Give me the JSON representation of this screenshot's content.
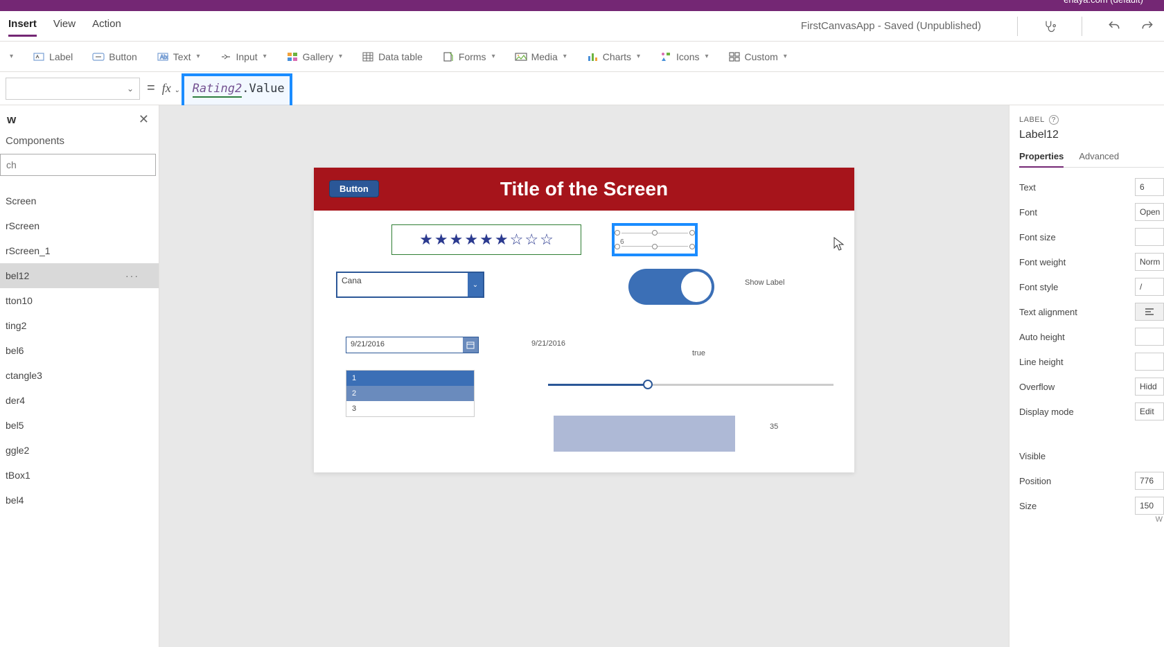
{
  "titlebar": {
    "text": "enaya.com (default)"
  },
  "menubar": {
    "tabs": [
      "Insert",
      "View",
      "Action"
    ],
    "active": 0,
    "status": "FirstCanvasApp - Saved (Unpublished)"
  },
  "ribbon": {
    "items": [
      "Label",
      "Button",
      "Text",
      "Input",
      "Gallery",
      "Data table",
      "Forms",
      "Media",
      "Charts",
      "Icons",
      "Custom"
    ]
  },
  "formulabar": {
    "property": "",
    "fx": "fx",
    "ref": "Rating2",
    "suffix": ".Value"
  },
  "tree": {
    "title": "w",
    "subtitle": "Components",
    "search_placeholder": "ch",
    "items": [
      {
        "label": "Screen"
      },
      {
        "label": "rScreen"
      },
      {
        "label": "rScreen_1"
      },
      {
        "label": "bel12",
        "selected": true,
        "more": true
      },
      {
        "label": "tton10"
      },
      {
        "label": "ting2"
      },
      {
        "label": "bel6"
      },
      {
        "label": "ctangle3"
      },
      {
        "label": "der4"
      },
      {
        "label": "bel5"
      },
      {
        "label": "ggle2"
      },
      {
        "label": "tBox1"
      },
      {
        "label": "bel4"
      }
    ]
  },
  "canvas": {
    "title": "Title of the Screen",
    "button": "Button",
    "rating_max": 9,
    "rating_value": 6,
    "label_selected": "6",
    "combo": "Cana",
    "date": "9/21/2016",
    "date_label": "9/21/2016",
    "toggle_label": "Show Label",
    "true_label": "true",
    "list": [
      "1",
      "2",
      "3"
    ],
    "slider_label": "35"
  },
  "props": {
    "type": "LABEL",
    "name": "Label12",
    "tabs": [
      "Properties",
      "Advanced"
    ],
    "rows": [
      {
        "label": "Text",
        "value": "6"
      },
      {
        "label": "Font",
        "value": "Open"
      },
      {
        "label": "Font size",
        "value": ""
      },
      {
        "label": "Font weight",
        "value": "Norm"
      },
      {
        "label": "Font style",
        "value": "/"
      },
      {
        "label": "Text alignment",
        "align": true
      },
      {
        "label": "Auto height",
        "value": ""
      },
      {
        "label": "Line height",
        "value": ""
      },
      {
        "label": "Overflow",
        "value": "Hidd"
      },
      {
        "label": "Display mode",
        "value": "Edit"
      }
    ],
    "rows2": [
      {
        "label": "Visible"
      },
      {
        "label": "Position",
        "value": "776"
      },
      {
        "label": "Size",
        "value": "150"
      }
    ],
    "wrap": "W"
  }
}
